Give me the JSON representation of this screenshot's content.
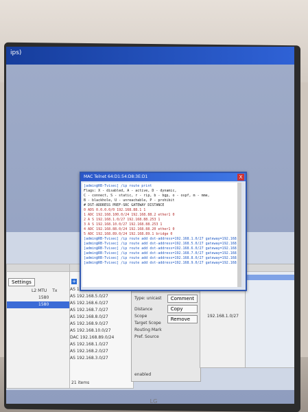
{
  "window": {
    "title": "ips)"
  },
  "terminal": {
    "title": "MAC Telnet 64:D1:54:D8:3E:D1",
    "close_label": "X",
    "lines": [
      {
        "text": "[admin@RB-Tvisec] /ip route print",
        "kind": "prompt"
      },
      {
        "text": "Flags: X - disabled, A - active, D - dynamic,",
        "kind": "normal"
      },
      {
        "text": "C - connect, S - static, r - rip, b - bgp, o - ospf, m - mme,",
        "kind": "normal"
      },
      {
        "text": "B - blackhole, U - unreachable, P - prohibit",
        "kind": "normal"
      },
      {
        "text": " #   DST-ADDRESS        PREF-SRC       GATEWAY          DISTANCE",
        "kind": "normal"
      },
      {
        "text": " 0 ADS 0.0.0.0/0                        192.168.88.1       1",
        "kind": "route"
      },
      {
        "text": " 1 ADC 192.168.100.0/24  192.168.88.2  ether1             0",
        "kind": "route"
      },
      {
        "text": " 2 A S 192.168.1.0/27                  192.168.88.253     1",
        "kind": "route"
      },
      {
        "text": " 3 A S 192.168.10.0/27                 192.168.88.253     1",
        "kind": "route"
      },
      {
        "text": " 4 ADC 192.168.88.0/24  192.168.88.20  ether1             0",
        "kind": "route"
      },
      {
        "text": " 5 ADC 192.168.89.0/24  192.168.89.1   bridge             0",
        "kind": "route"
      },
      {
        "text": "[admin@RB-Tvisec] /ip route add dst-address=192.168.1.0/27 gateway=192.168.88.253",
        "kind": "prompt"
      },
      {
        "text": "[admin@RB-Tvisec] /ip route add dst-address=192.168.5.0/27 gateway=192.168.88.253",
        "kind": "prompt"
      },
      {
        "text": "[admin@RB-Tvisec] /ip route add dst-address=192.168.6.0/27 gateway=192.168.88.253",
        "kind": "prompt"
      },
      {
        "text": "[admin@RB-Tvisec] /ip route add dst-address=192.168.7.0/27 gateway=192.168.88.253",
        "kind": "prompt"
      },
      {
        "text": "[admin@RB-Tvisec] /ip route add dst-address=192.168.8.0/27 gateway=192.168.88.253",
        "kind": "prompt"
      },
      {
        "text": "[admin@RB-Tvisec] /ip route add dst-address=192.168.9.0/27 gateway=192.168.88.253",
        "kind": "prompt"
      }
    ]
  },
  "left_panel": {
    "settings_button": "Settings",
    "col_l2mtu": "L2 MTU",
    "col_tx": "Tx",
    "row1_value": "1580",
    "row2_value": "1580"
  },
  "mid_panel": {
    "rows": [
      "AS  192.168.1.0/27",
      "AS  192.168.5.0/27",
      "AS  192.168.6.0/27",
      "AS  192.168.7.0/27",
      "AS  192.168.8.0/27",
      "AS  192.168.9.0/27",
      "AS  192.168.10.0/27",
      "DAC 192.168.89.0/24",
      "AS  192.168.1.0/27",
      "AS  192.168.2.0/27",
      "AS  192.168.3.0/27"
    ],
    "items_count": "21 items"
  },
  "center_panel": {
    "type_label": "Type: unicast",
    "distance_label": "Distance",
    "scope_label": "Scope",
    "target_scope_label": "Target Scope",
    "routing_mark_label": "Routing Mark",
    "pref_source_label": "Pref. Source",
    "status": "enabled",
    "buttons": [
      "Comment",
      "Copy",
      "Remove"
    ]
  },
  "right_panel": {
    "label": "192.168.1.0/27"
  },
  "taskbar": {
    "items": [
      "",
      "",
      "",
      "",
      ""
    ]
  },
  "monitor_brand": "LG"
}
